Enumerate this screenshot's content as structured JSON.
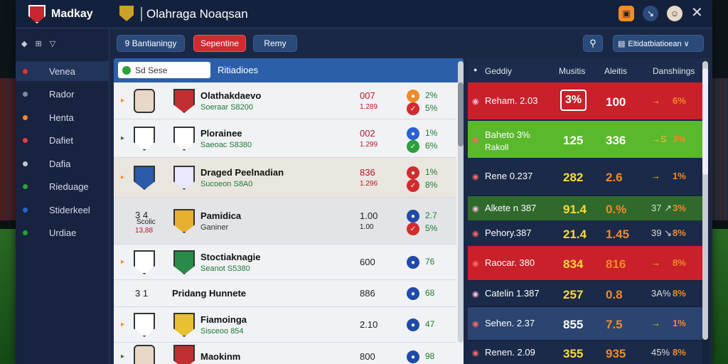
{
  "app": {
    "title": "Madkay",
    "page_title": "Olahraga Noaqsan"
  },
  "colors": {
    "accent_red": "#d12a2f",
    "accent_blue": "#2c5fa8",
    "green": "#2aa13a"
  },
  "topbar": {
    "icons": [
      "calendar-icon",
      "notification-icon",
      "user-avatar-icon",
      "close-icon"
    ]
  },
  "sidebar": {
    "top_icons": "◆ ⊞ ▽",
    "items": [
      {
        "label": "Venea",
        "dot": "#e0333a"
      },
      {
        "label": "Rador",
        "dot": "#7f8aa0"
      },
      {
        "label": "Henta",
        "dot": "#f08a2a"
      },
      {
        "label": "Dafiet",
        "dot": "#e04040"
      },
      {
        "label": "Dafia",
        "dot": "#c0c8d8"
      },
      {
        "label": "Rieduage",
        "dot": "#2aa13a"
      },
      {
        "label": "Stiderkeel",
        "dot": "#2a60d0"
      },
      {
        "label": "Urdiae",
        "dot": "#2aa13a"
      }
    ]
  },
  "tabs": [
    {
      "label": "9 Bantianingy",
      "active": false
    },
    {
      "label": "Sepentine",
      "active": true
    },
    {
      "label": "Remy",
      "active": false
    }
  ],
  "toolbar": {
    "filter_label": "Eltidatbiatioean ∨"
  },
  "left_panel": {
    "search_value": "Sd  Sese",
    "title": "Ritiadioes",
    "rows": [
      {
        "name": "Olathakdaevo",
        "sub": "Soeraar S8200",
        "v1": "007",
        "v2": "1.289",
        "p1": "2%",
        "p2": "5%"
      },
      {
        "name": "Plorainee",
        "sub": "Saeoac S8380",
        "v1": "002",
        "v2": "1.299",
        "p1": "1%",
        "p2": "6%"
      },
      {
        "name": "Draged Peelnadian",
        "sub": "Sucoeon S8A0",
        "v1": "836",
        "v2": "1.296",
        "p1": "1%",
        "p2": "8%"
      },
      {
        "name": "Pamidica",
        "sub": "Ganiner",
        "left1": "3 4",
        "left2": "Scolic",
        "left3": "13,88",
        "v1": "1.00",
        "v2": "1.00",
        "p1": "2.7",
        "p2": "5%"
      },
      {
        "name": "Stoctiaknagie",
        "sub": "Seanot S5380",
        "v1": "600",
        "p1": "76"
      },
      {
        "name": "Pridang Hunnete",
        "left1": "3 1",
        "v1": "886",
        "p1": "68"
      },
      {
        "name": "Fiamoinga",
        "sub": "Sisceoo 854",
        "v1": "2.10",
        "p1": "47"
      },
      {
        "name": "Maokinm",
        "v1": "800",
        "p1": "98"
      }
    ]
  },
  "right_panel": {
    "headers": [
      "Geddiy",
      "Musitis",
      "Aleitis",
      "Danshiings"
    ],
    "rows": [
      {
        "name": "Reham. 2.03",
        "a": "3%",
        "b": "100",
        "arrow": "→",
        "c": "6%",
        "bg": "#c9202a"
      },
      {
        "name": "Baheto 3%",
        "sub": "Rakoll",
        "a": "125",
        "b": "336",
        "arrow": "→S",
        "c": "3%",
        "bg": "#5ab82c"
      },
      {
        "name": "Rene 0.237",
        "a": "282",
        "b": "2.6",
        "arrow": "→",
        "c": "1%",
        "bg": "#1b2a48"
      },
      {
        "name": "Alkete n 387",
        "a": "91.4",
        "b": "0.%",
        "arrow": "37 ↗",
        "c": "3%",
        "bg": "#2f6a2c"
      },
      {
        "name": "Pehory.387",
        "a": "21.4",
        "b": "1.45",
        "arrow": "39 ↘",
        "c": "8%",
        "bg": "#1b2a48"
      },
      {
        "name": "Raocar. 380",
        "a": "834",
        "b": "816",
        "arrow": "→",
        "c": "8%",
        "bg": "#c9202a"
      },
      {
        "name": "Catelin 1.387",
        "a": "257",
        "b": "0.8",
        "arrow": "3A%",
        "c": "8%",
        "bg": "#1b2a48"
      },
      {
        "name": "Sehen. 2.37",
        "a": "855",
        "b": "7.5",
        "arrow": "→",
        "c": "1%",
        "bg": "#2b4470"
      },
      {
        "name": "Renen. 2.09",
        "a": "355",
        "b": "935",
        "arrow": "45%",
        "c": "8%",
        "bg": "#1b2a48"
      }
    ]
  }
}
